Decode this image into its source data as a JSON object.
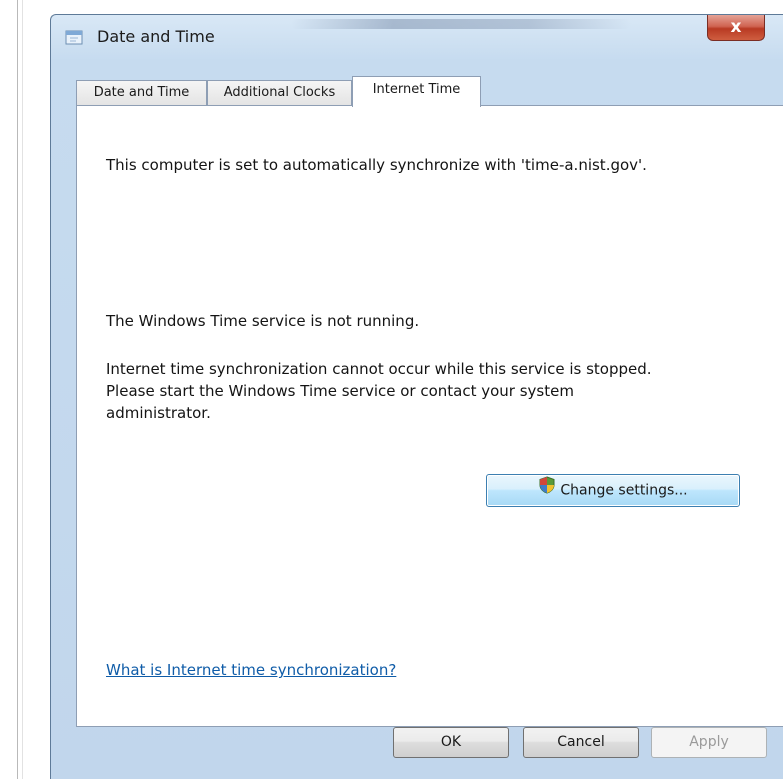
{
  "window": {
    "title": "Date and Time",
    "close_glyph": "x"
  },
  "tabs": [
    {
      "label": "Date and Time"
    },
    {
      "label": "Additional Clocks"
    },
    {
      "label": "Internet Time"
    }
  ],
  "active_tab": "Internet Time",
  "content": {
    "sync_message": "This computer is set to automatically synchronize with 'time-a.nist.gov'.",
    "service_status": "The Windows Time service is not running.",
    "service_detail_line1": "Internet time synchronization cannot occur while this service is stopped.",
    "service_detail_line2": "Please start the Windows Time service or contact your system",
    "service_detail_line3": "administrator.",
    "change_settings_label": "Change settings...",
    "help_link": "What is Internet time synchronization?"
  },
  "footer": {
    "ok_label": "OK",
    "cancel_label": "Cancel",
    "apply_label": "Apply"
  },
  "icons": {
    "window_icon": "date-time-icon",
    "change_settings_icon": "uac-shield-icon",
    "close_icon": "close-icon"
  }
}
